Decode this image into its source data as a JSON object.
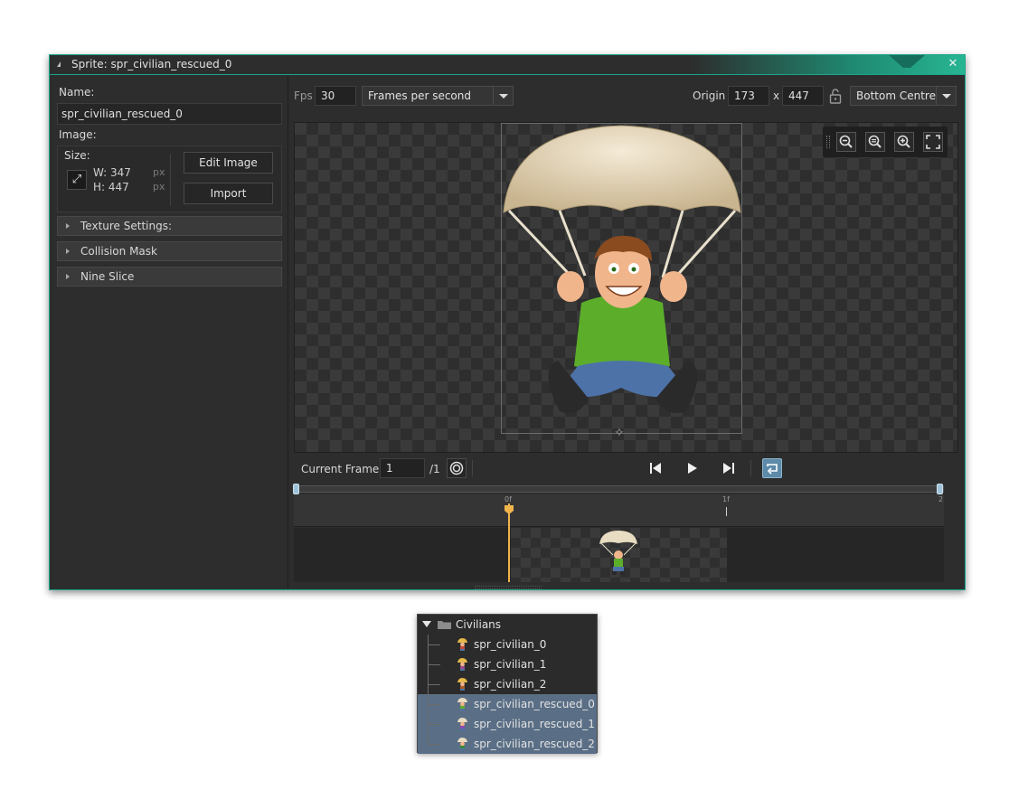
{
  "window": {
    "title": "Sprite: spr_civilian_rescued_0",
    "close_glyph": "✕"
  },
  "left": {
    "name_label": "Name:",
    "name_value": "spr_civilian_rescued_0",
    "image_label": "Image:",
    "size_label": "Size:",
    "width_text": "W: 347",
    "height_text": "H: 447",
    "unit": "px",
    "edit_image_label": "Edit Image",
    "import_label": "Import",
    "sections": [
      "Texture Settings:",
      "Collision Mask",
      "Nine Slice"
    ]
  },
  "toolbar": {
    "fps_label": "Fps",
    "fps_value": "30",
    "fps_mode": "Frames per second",
    "origin_label": "Origin",
    "origin_x": "173",
    "origin_sep": "x",
    "origin_y": "447",
    "origin_preset": "Bottom Centre"
  },
  "playback": {
    "current_frame_label": "Current Frame:",
    "current_frame_value": "1",
    "total_frames": "/1"
  },
  "timeline": {
    "ticks": [
      "0f",
      "1f",
      "2"
    ]
  },
  "tree": {
    "folder": "Civilians",
    "items": [
      {
        "label": "spr_civilian_0",
        "selected": false
      },
      {
        "label": "spr_civilian_1",
        "selected": false
      },
      {
        "label": "spr_civilian_2",
        "selected": false
      },
      {
        "label": "spr_civilian_rescued_0",
        "selected": true
      },
      {
        "label": "spr_civilian_rescued_1",
        "selected": true
      },
      {
        "label": "spr_civilian_rescued_2",
        "selected": true
      }
    ]
  },
  "colors": {
    "accent": "#1aa58a",
    "selection": "#5a6f86",
    "playhead": "#f0b54a",
    "slider_handle": "#9fc2d8"
  }
}
